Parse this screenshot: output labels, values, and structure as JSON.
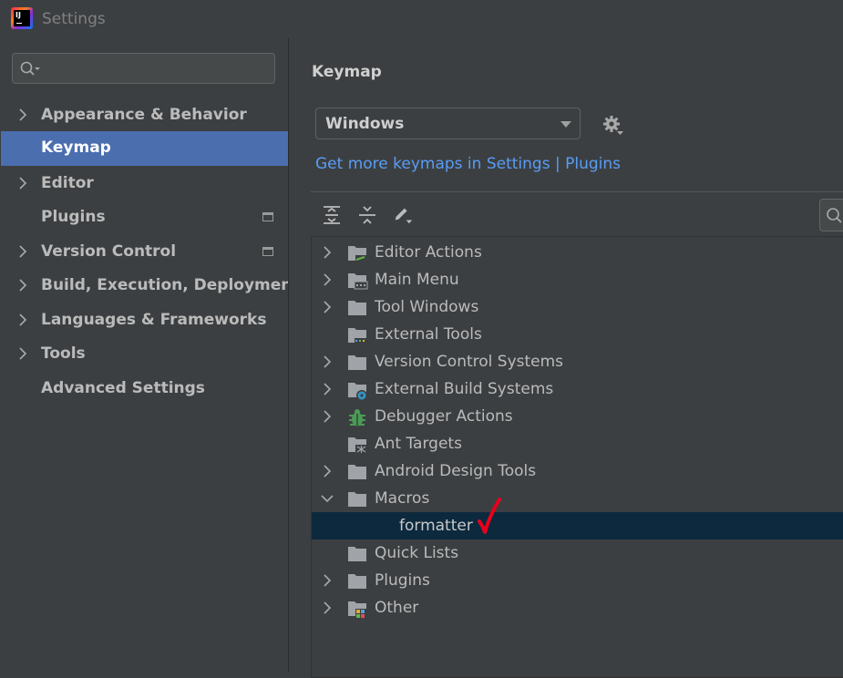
{
  "window": {
    "title": "Settings",
    "app_icon": "intellij-logo-icon",
    "app_icon_text": "IJ"
  },
  "sidebar": {
    "search_placeholder": "",
    "items": [
      {
        "label": "Appearance & Behavior",
        "expandable": true,
        "selected": false
      },
      {
        "label": "Keymap",
        "expandable": false,
        "selected": true
      },
      {
        "label": "Editor",
        "expandable": true,
        "selected": false
      },
      {
        "label": "Plugins",
        "expandable": false,
        "selected": false,
        "project_icon": true
      },
      {
        "label": "Version Control",
        "expandable": true,
        "selected": false,
        "project_icon": true
      },
      {
        "label": "Build, Execution, Deployment",
        "expandable": true,
        "selected": false
      },
      {
        "label": "Languages & Frameworks",
        "expandable": true,
        "selected": false
      },
      {
        "label": "Tools",
        "expandable": true,
        "selected": false
      },
      {
        "label": "Advanced Settings",
        "expandable": false,
        "selected": false
      }
    ]
  },
  "main": {
    "title": "Keymap",
    "keymap_select": {
      "value": "Windows"
    },
    "link_text": "Get more keymaps in Settings | Plugins",
    "toolbar": [
      "expand-all-icon",
      "collapse-all-icon",
      "edit-shortcut-icon"
    ],
    "tree": [
      {
        "label": "Editor Actions",
        "expandable": true,
        "icon": "editor-actions-folder-icon"
      },
      {
        "label": "Main Menu",
        "expandable": true,
        "icon": "main-menu-folder-icon"
      },
      {
        "label": "Tool Windows",
        "expandable": true,
        "icon": "folder-icon"
      },
      {
        "label": "External Tools",
        "expandable": false,
        "icon": "external-tools-folder-icon"
      },
      {
        "label": "Version Control Systems",
        "expandable": true,
        "icon": "folder-icon"
      },
      {
        "label": "External Build Systems",
        "expandable": true,
        "icon": "build-systems-folder-icon"
      },
      {
        "label": "Debugger Actions",
        "expandable": true,
        "icon": "bug-icon"
      },
      {
        "label": "Ant Targets",
        "expandable": false,
        "icon": "ant-folder-icon"
      },
      {
        "label": "Android Design Tools",
        "expandable": true,
        "icon": "folder-icon"
      },
      {
        "label": "Macros",
        "expandable": true,
        "expanded": true,
        "icon": "folder-icon"
      },
      {
        "label": "formatter",
        "expandable": false,
        "selected": true,
        "icon": ""
      },
      {
        "label": "Quick Lists",
        "expandable": false,
        "icon": "folder-icon"
      },
      {
        "label": "Plugins",
        "expandable": true,
        "icon": "folder-icon"
      },
      {
        "label": "Other",
        "expandable": true,
        "icon": "other-folder-icon"
      }
    ],
    "annotation_icon": "red-checkmark-icon"
  },
  "colors": {
    "background": "#3c3f41",
    "selection": "#4b6eaf",
    "tree_selection": "#0d293e",
    "link": "#589df6",
    "annotation": "#e8001c"
  }
}
